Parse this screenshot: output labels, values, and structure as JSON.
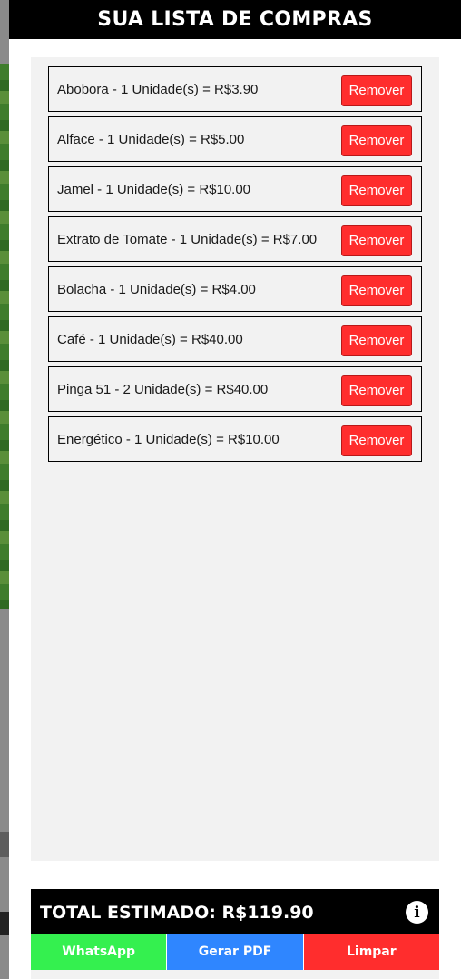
{
  "header": {
    "title": "SUA LISTA DE COMPRAS"
  },
  "items": [
    {
      "text": "Abobora - 1 Unidade(s) = R$3.90",
      "remove_label": "Remover"
    },
    {
      "text": "Alface - 1 Unidade(s) = R$5.00",
      "remove_label": "Remover"
    },
    {
      "text": "Jamel - 1 Unidade(s) = R$10.00",
      "remove_label": "Remover"
    },
    {
      "text": "Extrato de Tomate - 1 Unidade(s) = R$7.00",
      "remove_label": "Remover"
    },
    {
      "text": "Bolacha - 1 Unidade(s) = R$4.00",
      "remove_label": "Remover"
    },
    {
      "text": "Café - 1 Unidade(s) = R$40.00",
      "remove_label": "Remover"
    },
    {
      "text": "Pinga 51 - 2 Unidade(s) = R$40.00",
      "remove_label": "Remover"
    },
    {
      "text": "Energético - 1 Unidade(s) = R$10.00",
      "remove_label": "Remover"
    }
  ],
  "total": {
    "label": "TOTAL ESTIMADO: R$119.90",
    "info_icon": "info-icon"
  },
  "actions": {
    "whatsapp": "WhatsApp",
    "pdf": "Gerar PDF",
    "clear": "Limpar"
  },
  "colors": {
    "header_bg": "#000000",
    "remove": "#ff2d2d",
    "whatsapp": "#34f04f",
    "pdf": "#2f86ff",
    "clear": "#ff2d2d"
  }
}
